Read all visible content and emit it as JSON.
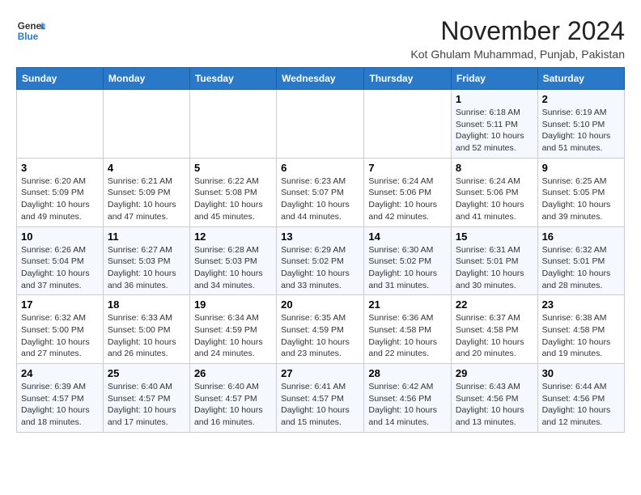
{
  "logo": {
    "line1": "General",
    "line2": "Blue"
  },
  "title": "November 2024",
  "location": "Kot Ghulam Muhammad, Punjab, Pakistan",
  "days_of_week": [
    "Sunday",
    "Monday",
    "Tuesday",
    "Wednesday",
    "Thursday",
    "Friday",
    "Saturday"
  ],
  "weeks": [
    [
      {
        "day": "",
        "content": ""
      },
      {
        "day": "",
        "content": ""
      },
      {
        "day": "",
        "content": ""
      },
      {
        "day": "",
        "content": ""
      },
      {
        "day": "",
        "content": ""
      },
      {
        "day": "1",
        "content": "Sunrise: 6:18 AM\nSunset: 5:11 PM\nDaylight: 10 hours\nand 52 minutes."
      },
      {
        "day": "2",
        "content": "Sunrise: 6:19 AM\nSunset: 5:10 PM\nDaylight: 10 hours\nand 51 minutes."
      }
    ],
    [
      {
        "day": "3",
        "content": "Sunrise: 6:20 AM\nSunset: 5:09 PM\nDaylight: 10 hours\nand 49 minutes."
      },
      {
        "day": "4",
        "content": "Sunrise: 6:21 AM\nSunset: 5:09 PM\nDaylight: 10 hours\nand 47 minutes."
      },
      {
        "day": "5",
        "content": "Sunrise: 6:22 AM\nSunset: 5:08 PM\nDaylight: 10 hours\nand 45 minutes."
      },
      {
        "day": "6",
        "content": "Sunrise: 6:23 AM\nSunset: 5:07 PM\nDaylight: 10 hours\nand 44 minutes."
      },
      {
        "day": "7",
        "content": "Sunrise: 6:24 AM\nSunset: 5:06 PM\nDaylight: 10 hours\nand 42 minutes."
      },
      {
        "day": "8",
        "content": "Sunrise: 6:24 AM\nSunset: 5:06 PM\nDaylight: 10 hours\nand 41 minutes."
      },
      {
        "day": "9",
        "content": "Sunrise: 6:25 AM\nSunset: 5:05 PM\nDaylight: 10 hours\nand 39 minutes."
      }
    ],
    [
      {
        "day": "10",
        "content": "Sunrise: 6:26 AM\nSunset: 5:04 PM\nDaylight: 10 hours\nand 37 minutes."
      },
      {
        "day": "11",
        "content": "Sunrise: 6:27 AM\nSunset: 5:03 PM\nDaylight: 10 hours\nand 36 minutes."
      },
      {
        "day": "12",
        "content": "Sunrise: 6:28 AM\nSunset: 5:03 PM\nDaylight: 10 hours\nand 34 minutes."
      },
      {
        "day": "13",
        "content": "Sunrise: 6:29 AM\nSunset: 5:02 PM\nDaylight: 10 hours\nand 33 minutes."
      },
      {
        "day": "14",
        "content": "Sunrise: 6:30 AM\nSunset: 5:02 PM\nDaylight: 10 hours\nand 31 minutes."
      },
      {
        "day": "15",
        "content": "Sunrise: 6:31 AM\nSunset: 5:01 PM\nDaylight: 10 hours\nand 30 minutes."
      },
      {
        "day": "16",
        "content": "Sunrise: 6:32 AM\nSunset: 5:01 PM\nDaylight: 10 hours\nand 28 minutes."
      }
    ],
    [
      {
        "day": "17",
        "content": "Sunrise: 6:32 AM\nSunset: 5:00 PM\nDaylight: 10 hours\nand 27 minutes."
      },
      {
        "day": "18",
        "content": "Sunrise: 6:33 AM\nSunset: 5:00 PM\nDaylight: 10 hours\nand 26 minutes."
      },
      {
        "day": "19",
        "content": "Sunrise: 6:34 AM\nSunset: 4:59 PM\nDaylight: 10 hours\nand 24 minutes."
      },
      {
        "day": "20",
        "content": "Sunrise: 6:35 AM\nSunset: 4:59 PM\nDaylight: 10 hours\nand 23 minutes."
      },
      {
        "day": "21",
        "content": "Sunrise: 6:36 AM\nSunset: 4:58 PM\nDaylight: 10 hours\nand 22 minutes."
      },
      {
        "day": "22",
        "content": "Sunrise: 6:37 AM\nSunset: 4:58 PM\nDaylight: 10 hours\nand 20 minutes."
      },
      {
        "day": "23",
        "content": "Sunrise: 6:38 AM\nSunset: 4:58 PM\nDaylight: 10 hours\nand 19 minutes."
      }
    ],
    [
      {
        "day": "24",
        "content": "Sunrise: 6:39 AM\nSunset: 4:57 PM\nDaylight: 10 hours\nand 18 minutes."
      },
      {
        "day": "25",
        "content": "Sunrise: 6:40 AM\nSunset: 4:57 PM\nDaylight: 10 hours\nand 17 minutes."
      },
      {
        "day": "26",
        "content": "Sunrise: 6:40 AM\nSunset: 4:57 PM\nDaylight: 10 hours\nand 16 minutes."
      },
      {
        "day": "27",
        "content": "Sunrise: 6:41 AM\nSunset: 4:57 PM\nDaylight: 10 hours\nand 15 minutes."
      },
      {
        "day": "28",
        "content": "Sunrise: 6:42 AM\nSunset: 4:56 PM\nDaylight: 10 hours\nand 14 minutes."
      },
      {
        "day": "29",
        "content": "Sunrise: 6:43 AM\nSunset: 4:56 PM\nDaylight: 10 hours\nand 13 minutes."
      },
      {
        "day": "30",
        "content": "Sunrise: 6:44 AM\nSunset: 4:56 PM\nDaylight: 10 hours\nand 12 minutes."
      }
    ]
  ]
}
